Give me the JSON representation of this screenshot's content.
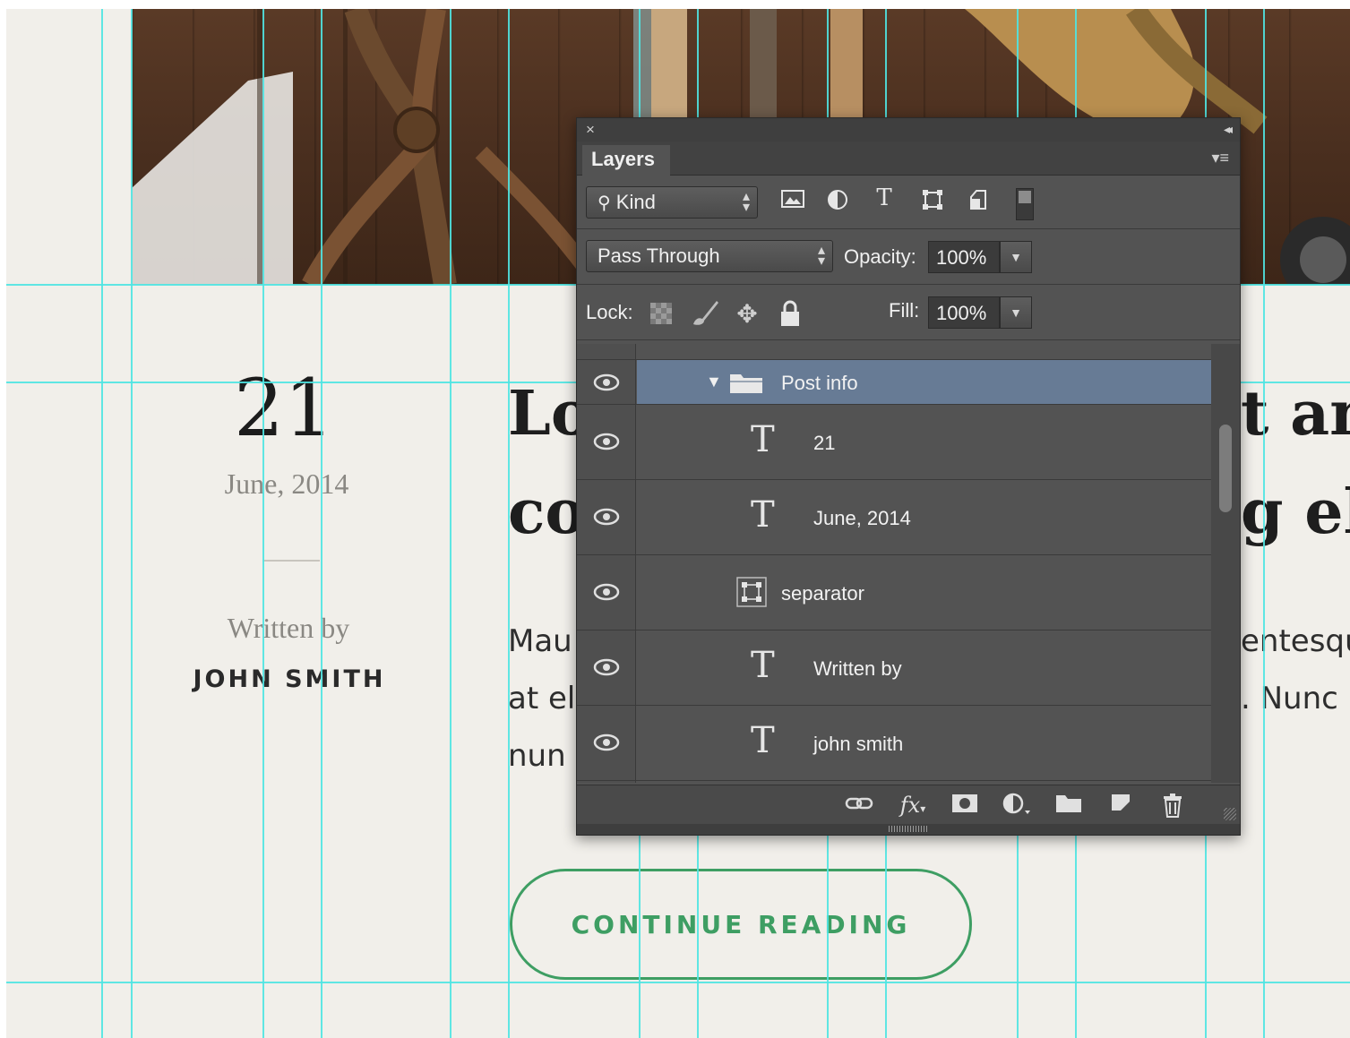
{
  "article": {
    "day": "21",
    "date": "June, 2014",
    "written_by": "Written by",
    "author": "JOHN SMITH",
    "title_line1_left": "Lo",
    "title_line1_right": "t an",
    "title_line2_left": "co",
    "title_line2_right": "g el",
    "body_line1_left": "Mau",
    "body_line1_right": "entesqu",
    "body_line2_left": "at el",
    "body_line2_right": ". Nunc",
    "body_line3_left": "nun",
    "continue_label": "CONTINUE READING"
  },
  "colors": {
    "guide": "#4fe4e2",
    "button_accent": "#3e9e63",
    "selected_layer": "#677b95",
    "panel_bg": "#535353"
  },
  "layers_panel": {
    "close_glyph": "×",
    "collapse_glyph": "◂◂",
    "tab_label": "Layers",
    "menu_glyph": "▾≡",
    "filter": {
      "kind_label": "Kind",
      "icons": [
        "image-filter-icon",
        "adjustment-filter-icon",
        "type-filter-icon",
        "shape-filter-icon",
        "smart-object-filter-icon",
        "filter-toggle"
      ]
    },
    "blend_mode": "Pass Through",
    "opacity_label": "Opacity:",
    "opacity_value": "100%",
    "lock_label": "Lock:",
    "lock_icons": [
      "lock-transparent-icon",
      "lock-pixels-icon",
      "lock-position-icon",
      "lock-all-icon"
    ],
    "fill_label": "Fill:",
    "fill_value": "100%",
    "type_glyph": "T",
    "layers": [
      {
        "name": "Post info",
        "kind": "group",
        "selected": true,
        "visible": true
      },
      {
        "name": "21",
        "kind": "text",
        "visible": true
      },
      {
        "name": "June, 2014",
        "kind": "text",
        "visible": true
      },
      {
        "name": "separator",
        "kind": "shape",
        "visible": true
      },
      {
        "name": "Written by",
        "kind": "text",
        "visible": true
      },
      {
        "name": "john smith",
        "kind": "text",
        "visible": true
      }
    ],
    "footer_icons": [
      "link-layers-icon",
      "fx-icon",
      "add-mask-icon",
      "adjustment-layer-icon",
      "new-group-icon",
      "new-layer-icon",
      "delete-layer-icon"
    ],
    "fx_label": "fx"
  }
}
